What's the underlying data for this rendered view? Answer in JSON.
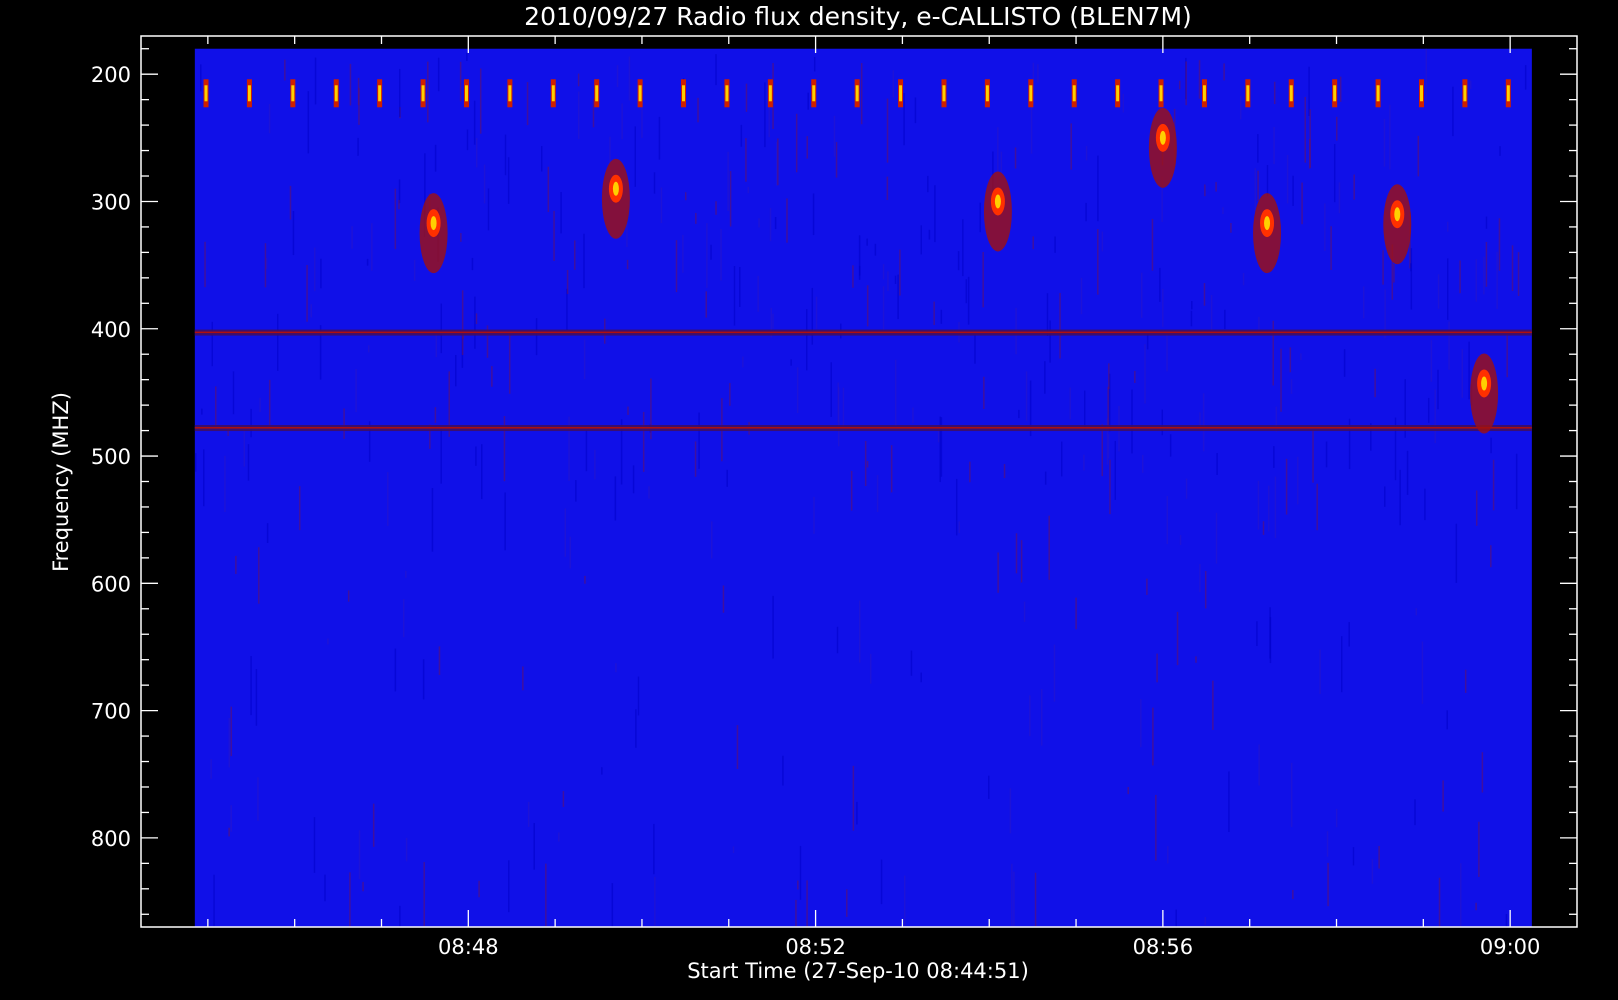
{
  "chart_data": {
    "type": "heatmap",
    "title": "2010/09/27  Radio flux density, e-CALLISTO (BLEN7M)",
    "xlabel": "Start Time (27-Sep-10 08:44:51)",
    "ylabel": "Frequency (MHZ)",
    "x_ticks": [
      {
        "label": "08:48",
        "minutes": 48
      },
      {
        "label": "08:52",
        "minutes": 52
      },
      {
        "label": "08:56",
        "minutes": 56
      },
      {
        "label": "09:00",
        "minutes": 60
      }
    ],
    "x_range_minutes": [
      44.23,
      60.77
    ],
    "data_x_range_minutes": [
      44.85,
      60.25
    ],
    "y_ticks": [
      200,
      300,
      400,
      500,
      600,
      700,
      800
    ],
    "ylim_mhz": [
      170,
      870
    ],
    "data_y_range_mhz": [
      180,
      870
    ],
    "colormap": [
      "#0000ff",
      "#2010d8",
      "#a01010",
      "#ff3000",
      "#ffd000",
      "#ffffff"
    ],
    "background_color": "#1010e8",
    "features": [
      {
        "kind": "periodic_interference",
        "freq_mhz": 215
      },
      {
        "kind": "band_artifact",
        "freq_mhz": 403
      },
      {
        "kind": "band_artifact",
        "freq_mhz": 478
      },
      {
        "kind": "burst",
        "time_minutes": 49.7,
        "freq_mhz": 290
      },
      {
        "kind": "burst",
        "time_minutes": 54.1,
        "freq_mhz": 300
      },
      {
        "kind": "burst",
        "time_minutes": 58.7,
        "freq_mhz": 310
      },
      {
        "kind": "burst",
        "time_minutes": 57.2,
        "freq_mhz": 317
      },
      {
        "kind": "burst",
        "time_minutes": 47.6,
        "freq_mhz": 317
      },
      {
        "kind": "burst",
        "time_minutes": 56.0,
        "freq_mhz": 250
      },
      {
        "kind": "burst",
        "time_minutes": 59.7,
        "freq_mhz": 443
      }
    ]
  }
}
